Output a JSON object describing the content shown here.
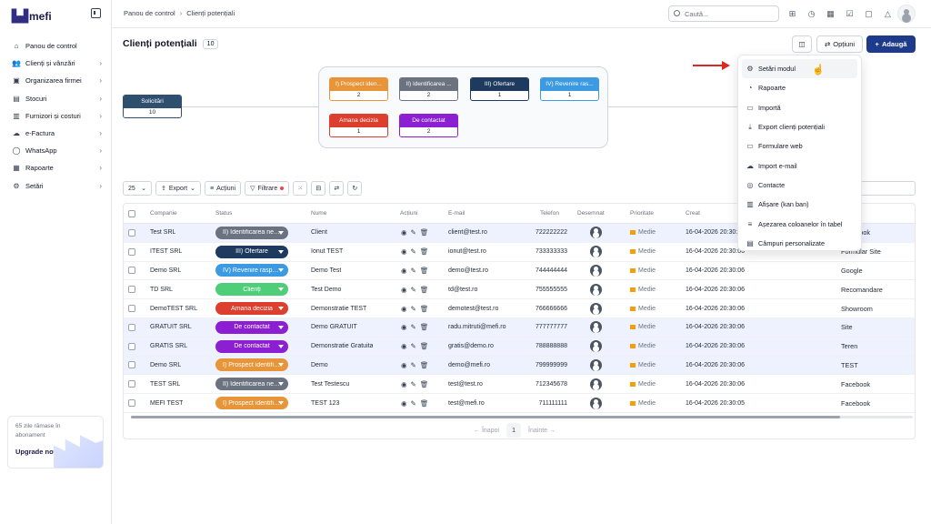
{
  "brand": "mefi",
  "sidebar": {
    "items": [
      {
        "label": "Panou de control",
        "icon": "home-icon",
        "glyph": "⌂"
      },
      {
        "label": "Clienți și vânzări",
        "icon": "users-icon",
        "glyph": "👥"
      },
      {
        "label": "Organizarea firmei",
        "icon": "briefcase-icon",
        "glyph": "▣"
      },
      {
        "label": "Stocuri",
        "icon": "box-icon",
        "glyph": "▤"
      },
      {
        "label": "Furnizori și costuri",
        "icon": "wallet-icon",
        "glyph": "▥"
      },
      {
        "label": "e-Factura",
        "icon": "cloud-icon",
        "glyph": "☁"
      },
      {
        "label": "WhatsApp",
        "icon": "whatsapp-icon",
        "glyph": "◯"
      },
      {
        "label": "Rapoarte",
        "icon": "clipboard-icon",
        "glyph": "▦"
      },
      {
        "label": "Setări",
        "icon": "gear-icon",
        "glyph": "⚙"
      }
    ],
    "trial": {
      "text": "65 zile rămase în abonament",
      "upgrade": "Upgrade now"
    }
  },
  "breadcrumb": {
    "root": "Panou de control",
    "current": "Clienți potențiali"
  },
  "search": {
    "placeholder": "Caută..."
  },
  "page": {
    "title": "Clienți potențiali",
    "count": "10",
    "options_label": "Opțiuni",
    "add_label": "Adaugă"
  },
  "funnel": {
    "source": {
      "label": "Solicitări",
      "count": "10",
      "color": "#2f4f6f"
    },
    "stages": [
      {
        "label": "I) Prospect iden...",
        "count": "2",
        "color": "#e8953a"
      },
      {
        "label": "II) Identificarea ...",
        "count": "2",
        "color": "#6b7280"
      },
      {
        "label": "III) Ofertare",
        "count": "1",
        "color": "#1e3a5f"
      },
      {
        "label": "IV) Revenire ras...",
        "count": "1",
        "color": "#3b9ae1"
      },
      {
        "label": "Amana decizia",
        "count": "1",
        "color": "#dc3f2e"
      },
      {
        "label": "De contactat",
        "count": "2",
        "color": "#8b1fd1"
      }
    ]
  },
  "toolbar": {
    "page_size": "25",
    "export": "Export",
    "actions": "Acțiuni",
    "filter": "Filtrare"
  },
  "table": {
    "headers": {
      "company": "Companie",
      "status": "Status",
      "name": "Nume",
      "actions": "Acțiuni",
      "email": "E-mail",
      "phone": "Telefon",
      "assigned": "Desemnat",
      "priority": "Prioritate",
      "created": "Creat",
      "source": ""
    },
    "rows": [
      {
        "company": "Test SRL",
        "status": "II) Identificarea nevoii",
        "status_color": "#6b7280",
        "name": "Client",
        "email": "client@test.ro",
        "phone": "722222222",
        "priority": "Medie",
        "created": "16-04-2026 20:30:06",
        "source": "Facebook",
        "highlight": true
      },
      {
        "company": "ITEST SRL",
        "status": "III) Ofertare",
        "status_color": "#1e3a5f",
        "name": "Ionut TEST",
        "email": "ionut@test.ro",
        "phone": "733333333",
        "priority": "Medie",
        "created": "16-04-2026 20:30:06",
        "source": "Formular Site",
        "highlight": false
      },
      {
        "company": "Demo SRL",
        "status": "IV) Revenire raspuns",
        "status_color": "#3b9ae1",
        "name": "Demo Test",
        "email": "demo@test.ro",
        "phone": "744444444",
        "priority": "Medie",
        "created": "16-04-2026 20:30:06",
        "source": "Google",
        "highlight": false
      },
      {
        "company": "TD SRL",
        "status": "Clienți",
        "status_color": "#4fce7a",
        "name": "Test Demo",
        "email": "td@test.ro",
        "phone": "755555555",
        "priority": "Medie",
        "created": "16-04-2026 20:30:06",
        "source": "Recomandare",
        "highlight": false
      },
      {
        "company": "DemoTEST SRL",
        "status": "Amana decizia",
        "status_color": "#dc3f2e",
        "name": "Demonstratie TEST",
        "email": "demotest@test.ro",
        "phone": "766666666",
        "priority": "Medie",
        "created": "16-04-2026 20:30:06",
        "source": "Showroom",
        "highlight": false
      },
      {
        "company": "GRATUIT SRL",
        "status": "De contactat",
        "status_color": "#8b1fd1",
        "name": "Demo GRATUIT",
        "email": "radu.mitruti@mefi.ro",
        "phone": "777777777",
        "priority": "Medie",
        "created": "16-04-2026 20:30:06",
        "source": "Site",
        "highlight": true
      },
      {
        "company": "GRATIS SRL",
        "status": "De contactat",
        "status_color": "#8b1fd1",
        "name": "Demonstratie Gratuita",
        "email": "gratis@demo.ro",
        "phone": "788888888",
        "priority": "Medie",
        "created": "16-04-2026 20:30:06",
        "source": "Teren",
        "highlight": true
      },
      {
        "company": "Demo SRL",
        "status": "I) Prospect identificat",
        "status_color": "#e8953a",
        "name": "Demo",
        "email": "demo@mefi.ro",
        "phone": "799999999",
        "priority": "Medie",
        "created": "16-04-2026 20:30:06",
        "source": "TEST",
        "highlight": true
      },
      {
        "company": "TEST SRL",
        "status": "II) Identificarea nevoii",
        "status_color": "#6b7280",
        "name": "Test Testescu",
        "email": "test@test.ro",
        "phone": "712345678",
        "priority": "Medie",
        "created": "16-04-2026 20:30:06",
        "source": "Facebook",
        "highlight": false
      },
      {
        "company": "MEFI TEST",
        "status": "I) Prospect identificat",
        "status_color": "#e8953a",
        "name": "TEST 123",
        "email": "test@mefi.ro",
        "phone": "711111111",
        "priority": "Medie",
        "created": "16-04-2026 20:30:05",
        "source": "Facebook",
        "highlight": false
      }
    ]
  },
  "pager": {
    "prev": "← Înapoi",
    "page": "1",
    "next": "Înainte →"
  },
  "menu": {
    "items": [
      {
        "label": "Setări modul",
        "icon": "gear-icon",
        "glyph": "⚙"
      },
      {
        "label": "Rapoarte",
        "icon": "chart-icon",
        "glyph": "◔"
      },
      {
        "label": "Importă",
        "icon": "document-icon",
        "glyph": "▭"
      },
      {
        "label": "Export clienți potențiali",
        "icon": "download-icon",
        "glyph": "⤓"
      },
      {
        "label": "Formulare web",
        "icon": "form-icon",
        "glyph": "▭"
      },
      {
        "label": "Import e-mail",
        "icon": "cloud-icon",
        "glyph": "☁"
      },
      {
        "label": "Contacte",
        "icon": "contacts-icon",
        "glyph": "◎"
      },
      {
        "label": "Afișare (kan ban)",
        "icon": "kanban-icon",
        "glyph": "▥"
      },
      {
        "label": "Așezarea coloanelor în tabel",
        "icon": "columns-icon",
        "glyph": "≡"
      },
      {
        "label": "Câmpuri personalizate",
        "icon": "fields-icon",
        "glyph": "▤"
      }
    ]
  }
}
